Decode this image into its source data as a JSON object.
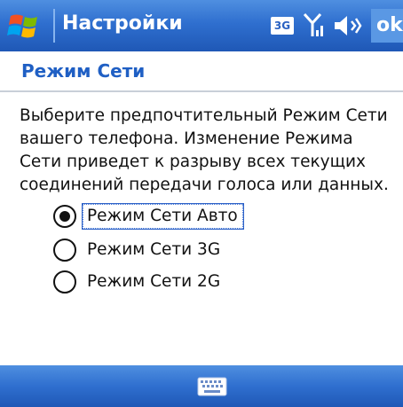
{
  "title_bar": {
    "title": "Настройки",
    "network_type": "3G",
    "ok_label": "ok",
    "icons": [
      "windows-start-icon",
      "signal-icon",
      "volume-icon"
    ]
  },
  "section": {
    "title": "Режим Сети"
  },
  "description": "Выберите предпочтительный Режим Сети вашего телефона. Изменение Режима Сети приведет к разрыву всех текущих соединений передачи голоса или данных.",
  "options": [
    {
      "label": "Режим Сети Авто",
      "selected": true
    },
    {
      "label": "Режим Сети 3G",
      "selected": false
    },
    {
      "label": "Режим Сети 2G",
      "selected": false
    }
  ],
  "bottom_bar": {
    "icon": "keyboard-icon"
  },
  "colors": {
    "title_bar_blue": "#2f6fcf",
    "section_title_blue": "#1f5fc4",
    "text": "#111111"
  }
}
